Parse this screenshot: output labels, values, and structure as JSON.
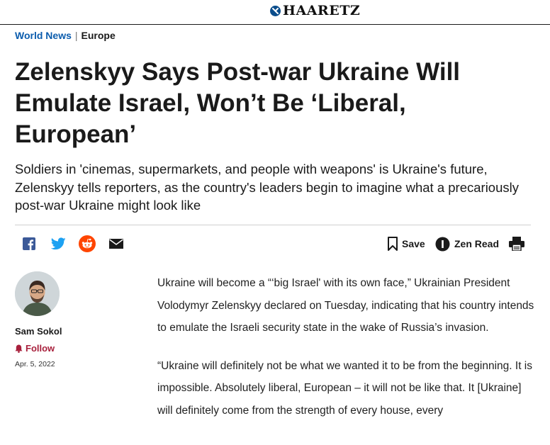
{
  "site": {
    "logo_text": "HAARETZ",
    "brand_color": "#0b4d8c"
  },
  "breadcrumb": {
    "section": "World News",
    "separator": "|",
    "subsection": "Europe"
  },
  "article": {
    "headline": "Zelenskyy Says Post-war Ukraine Will Emulate Israel, Won’t Be ‘Liberal, European’",
    "subheadline": "Soldiers in 'cinemas, supermarkets, and people with weapons' is Ukraine's future, Zelenskyy tells reporters, as the country's leaders begin to imagine what a precariously post-war Ukraine might look like",
    "paragraphs": [
      "Ukraine will become a “‘big Israel' with its own face,” Ukrainian President Volodymyr Zelenskyy declared on Tuesday, indicating that his country intends to emulate the Israeli security state in the wake of Russia’s invasion.",
      "“Ukraine will definitely not be what we wanted it to be from the beginning. It is impossible. Absolutely liberal, European – it will not be like that. It [Ukraine] will definitely come from the strength of every house, every"
    ]
  },
  "share": {
    "icons": [
      "facebook-icon",
      "twitter-icon",
      "reddit-icon",
      "email-icon"
    ],
    "colors": {
      "facebook": "#3b5998",
      "twitter": "#1da1f2",
      "reddit": "#ff4500",
      "email": "#1a1a1a"
    }
  },
  "toolbar": {
    "save_label": "Save",
    "zen_label": "Zen Read"
  },
  "author": {
    "name": "Sam Sokol",
    "follow_label": "Follow",
    "date": "Apr. 5, 2022",
    "follow_color": "#a8203c"
  }
}
